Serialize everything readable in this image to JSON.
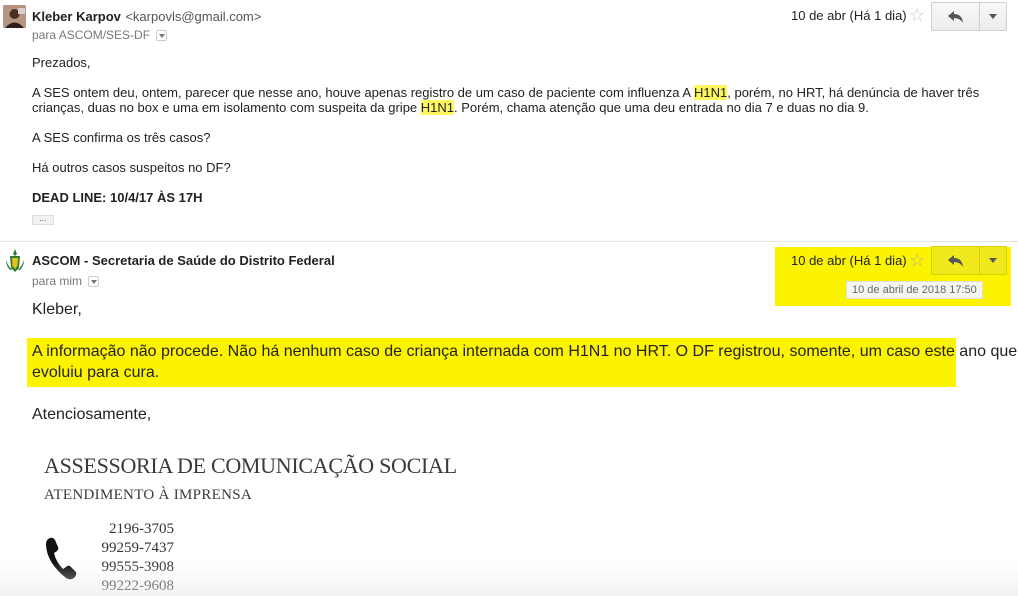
{
  "message1": {
    "sender_name": "Kleber Karpov",
    "sender_email": "<karpovls@gmail.com>",
    "recipient": "para ASCOM/SES-DF",
    "date": "10 de abr (Há 1 dia)",
    "greeting": "Prezados,",
    "para1_a": "A SES ontem deu, ontem, parecer que nesse ano, houve apenas registro de um caso de paciente com influenza A ",
    "para1_h1": "H1N1",
    "para1_b": ", porém, no HRT, há denúncia de haver três",
    "para1_c": "crianças, duas no box e uma em isolamento com suspeita da gripe ",
    "para1_h2": "H1N1",
    "para1_d": ". Porém, chama atenção que uma deu entrada no dia 7 e duas no dia 9.",
    "question1": "A SES confirma os três casos?",
    "question2": "Há outros casos suspeitos no DF?",
    "deadline": "DEAD LINE: 10/4/17 ÀS 17H",
    "elide_label": "..."
  },
  "message2": {
    "sender_name": "ASCOM - Secretaria de Saúde do Distrito Federal",
    "recipient": "para mim",
    "date": "10 de abr (Há 1 dia)",
    "tooltip": "10 de abril de 2018 17:50",
    "greeting": "Kleber,",
    "answer_line1": "A informação não procede. Não há nenhum caso de criança internada com H1N1 no HRT. O DF registrou, somente, um caso este ano que",
    "answer_line2": "evoluiu para cura.",
    "closing": "Atenciosamente,",
    "signature_title": "ASSESSORIA DE COMUNICAÇÃO SOCIAL",
    "signature_subtitle": "ATENDIMENTO À IMPRENSA",
    "phones": [
      "2196-3705",
      "99259-7437",
      "99555-3908",
      "99222-9608"
    ]
  },
  "icons": {
    "star": "☆",
    "reply": "reply-arrow-icon",
    "more": "chevron-down-icon",
    "phone": "phone-icon"
  },
  "colors": {
    "highlight_text": "#fcf75e",
    "highlight_box": "#fcf300"
  }
}
